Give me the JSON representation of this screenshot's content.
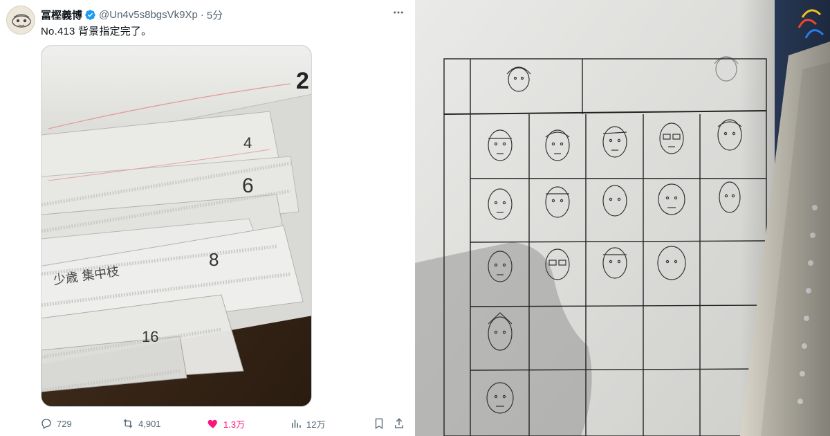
{
  "tweet": {
    "author_name": "冨樫義博",
    "handle": "@Un4v5s8bgsVk9Xp",
    "time": "5分",
    "text": "No.413 背景指定完了。",
    "verified_color": "#1d9bf0"
  },
  "photo_left": {
    "sheet_numbers": [
      "2",
      "4",
      "6",
      "8",
      "16"
    ],
    "handwritten_label": "少歳 集中枝"
  },
  "actions": {
    "reply_count": "729",
    "retweet_count": "4,901",
    "like_count": "1.3万",
    "views_count": "12万"
  },
  "colors": {
    "like": "#f91880",
    "muted": "#536471",
    "text": "#0f1419"
  }
}
